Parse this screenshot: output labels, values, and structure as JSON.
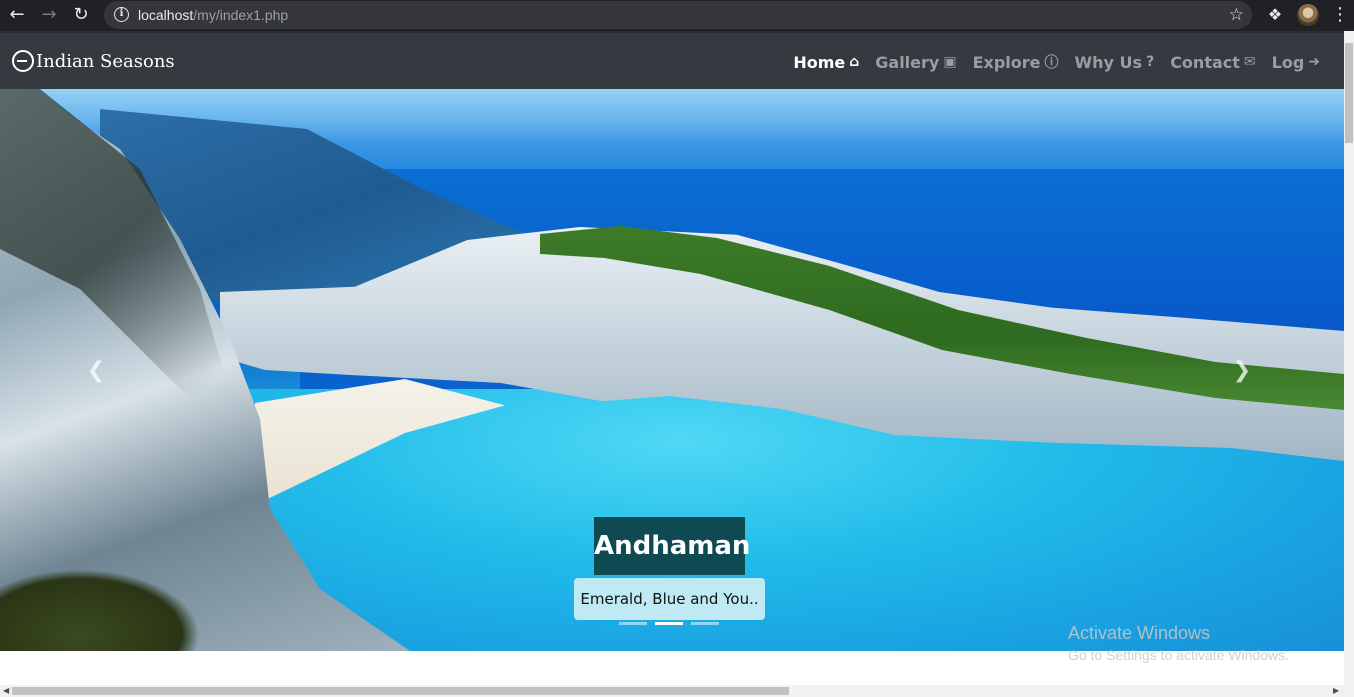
{
  "browser": {
    "back_icon": "arrow-left-icon",
    "forward_icon": "arrow-right-icon",
    "reload_icon": "reload-icon",
    "url_host": "localhost",
    "url_path": "/my/index1.php",
    "bookmark_icon": "star-icon",
    "extensions_icon": "puzzle-icon",
    "menu_icon": "kebab-menu-icon"
  },
  "navbar": {
    "brand": "Indian Seasons",
    "links": [
      {
        "label": "Home",
        "icon": "home-icon",
        "active": true
      },
      {
        "label": "Gallery",
        "icon": "image-icon",
        "active": false
      },
      {
        "label": "Explore",
        "icon": "info-icon",
        "active": false
      },
      {
        "label": "Why Us",
        "icon": "question-icon",
        "active": false
      },
      {
        "label": "Contact",
        "icon": "envelope-icon",
        "active": false
      },
      {
        "label": "Log",
        "icon": "sign-out-icon",
        "active": false
      }
    ]
  },
  "carousel": {
    "caption_title": "Andhaman",
    "caption_subtitle": "Emerald, Blue and You..",
    "active_slide": 2,
    "slide_count": 3
  },
  "watermark": {
    "title": "Activate Windows",
    "subtitle": "Go to Settings to activate Windows."
  }
}
